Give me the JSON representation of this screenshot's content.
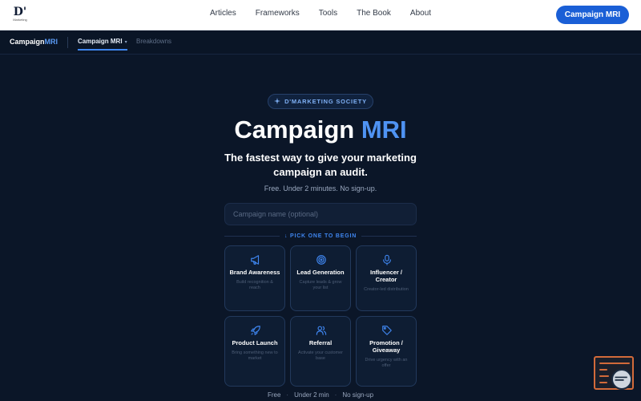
{
  "topnav": {
    "logo_mark": "D'",
    "logo_sub": "Marketing",
    "links": [
      "Articles",
      "Frameworks",
      "Tools",
      "The Book",
      "About"
    ],
    "cta_label": "Campaign MRI"
  },
  "subnav": {
    "brand_main": "Campaign",
    "brand_accent": "MRI",
    "active_tab": "Campaign MRI",
    "tab_breakdowns": "Breakdowns"
  },
  "hero": {
    "pill": "D'MARKETING SOCIETY",
    "title_main": "Campaign",
    "title_accent": "MRI",
    "subtitle": "The fastest way to give your marketing campaign an audit.",
    "note": "Free. Under 2 minutes. No sign-up.",
    "input_placeholder": "Campaign name (optional)",
    "input_value": "",
    "pick_label": "↓ PICK ONE TO BEGIN"
  },
  "cards": [
    {
      "title": "Brand Awareness",
      "desc": "Build recognition & reach",
      "icon": "megaphone-icon"
    },
    {
      "title": "Lead Generation",
      "desc": "Capture leads & grow your list",
      "icon": "target-icon"
    },
    {
      "title": "Influencer / Creator",
      "desc": "Creator-led distribution",
      "icon": "microphone-icon"
    },
    {
      "title": "Product Launch",
      "desc": "Bring something new to market",
      "icon": "rocket-icon"
    },
    {
      "title": "Referral",
      "desc": "Activate your customer base",
      "icon": "users-icon"
    },
    {
      "title": "Promotion / Giveaway",
      "desc": "Drive urgency with an offer",
      "icon": "tag-icon"
    }
  ],
  "footer": {
    "items": [
      "Free",
      "Under 2 min",
      "No sign-up"
    ],
    "separator": "·"
  },
  "colors": {
    "background": "#0b1628",
    "accent": "#3f86f0",
    "cta": "#1a5fd6",
    "widget": "#d26a3a"
  }
}
